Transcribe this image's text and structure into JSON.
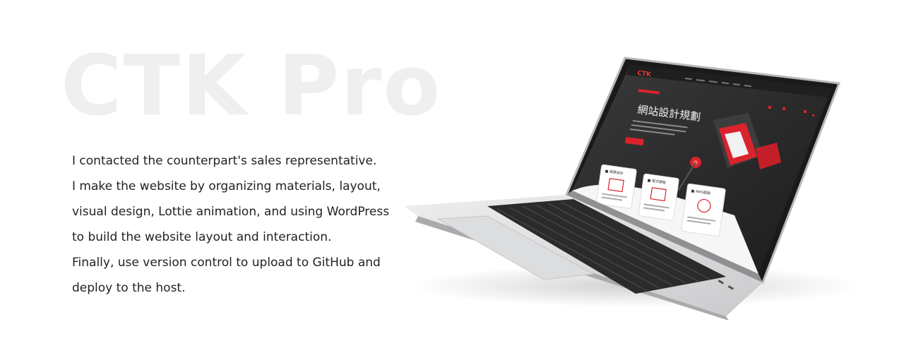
{
  "hero": {
    "title": "CTK Pro"
  },
  "description": {
    "lines": [
      "I contacted the counterpart's sales representative.",
      "I make the website by organizing materials, layout,",
      "visual design, Lottie animation, and using WordPress",
      "to build the website layout and interaction.",
      "Finally, use version control to upload to GitHub and",
      "deploy to the host."
    ]
  },
  "mockup": {
    "logo": "CTK",
    "heading": "網站設計規劃",
    "cards": [
      {
        "label": "■ 網頁設計"
      },
      {
        "label": "■ 程式開發"
      },
      {
        "label": "■ AWS服務"
      }
    ],
    "colors": {
      "accent": "#d9232d",
      "screen_bg": "#262626",
      "laptop_body": "#d6d7d9"
    }
  }
}
